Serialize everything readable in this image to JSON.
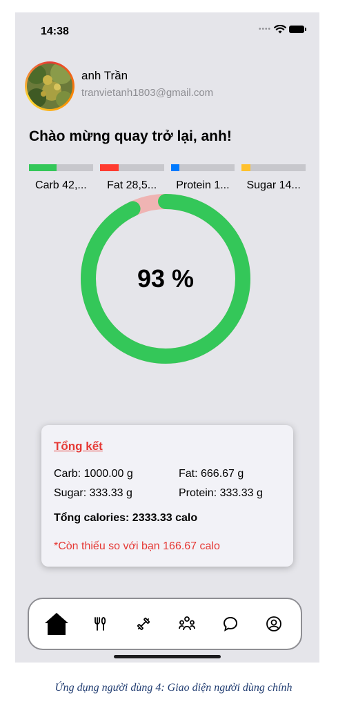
{
  "status": {
    "time": "14:38"
  },
  "user": {
    "name": "anh Trần",
    "email": "tranvietanh1803@gmail.com"
  },
  "greeting": "Chào mừng quay trở lại, anh!",
  "macros": [
    {
      "label": "Carb 42,...",
      "color": "#34c759",
      "progress": 0.43
    },
    {
      "label": "Fat 28,5...",
      "color": "#ff3b30",
      "progress": 0.29
    },
    {
      "label": "Protein 1...",
      "color": "#007aff",
      "progress": 0.14
    },
    {
      "label": "Sugar 14...",
      "color": "#ffc12e",
      "progress": 0.14
    }
  ],
  "progress": {
    "label": "93 %",
    "value": 0.93,
    "color": "#34c759",
    "track_color": "#efb4b3"
  },
  "summary": {
    "title": "Tổng kết",
    "carb": "Carb: 1000.00 g",
    "fat": "Fat: 666.67 g",
    "sugar": "Sugar: 333.33 g",
    "protein": "Protein: 333.33 g",
    "total": "Tổng calories: 2333.33 calo",
    "note": "*Còn thiếu so với bạn 166.67 calo"
  },
  "tabs": [
    {
      "name": "home",
      "icon": "home-icon"
    },
    {
      "name": "meals",
      "icon": "fork-knife-icon"
    },
    {
      "name": "workout",
      "icon": "dumbbell-icon"
    },
    {
      "name": "community",
      "icon": "people-icon"
    },
    {
      "name": "chat",
      "icon": "chat-bubble-icon"
    },
    {
      "name": "profile",
      "icon": "user-circle-icon"
    }
  ],
  "caption": "Ứng dụng người dùng 4: Giao diện người dùng chính"
}
